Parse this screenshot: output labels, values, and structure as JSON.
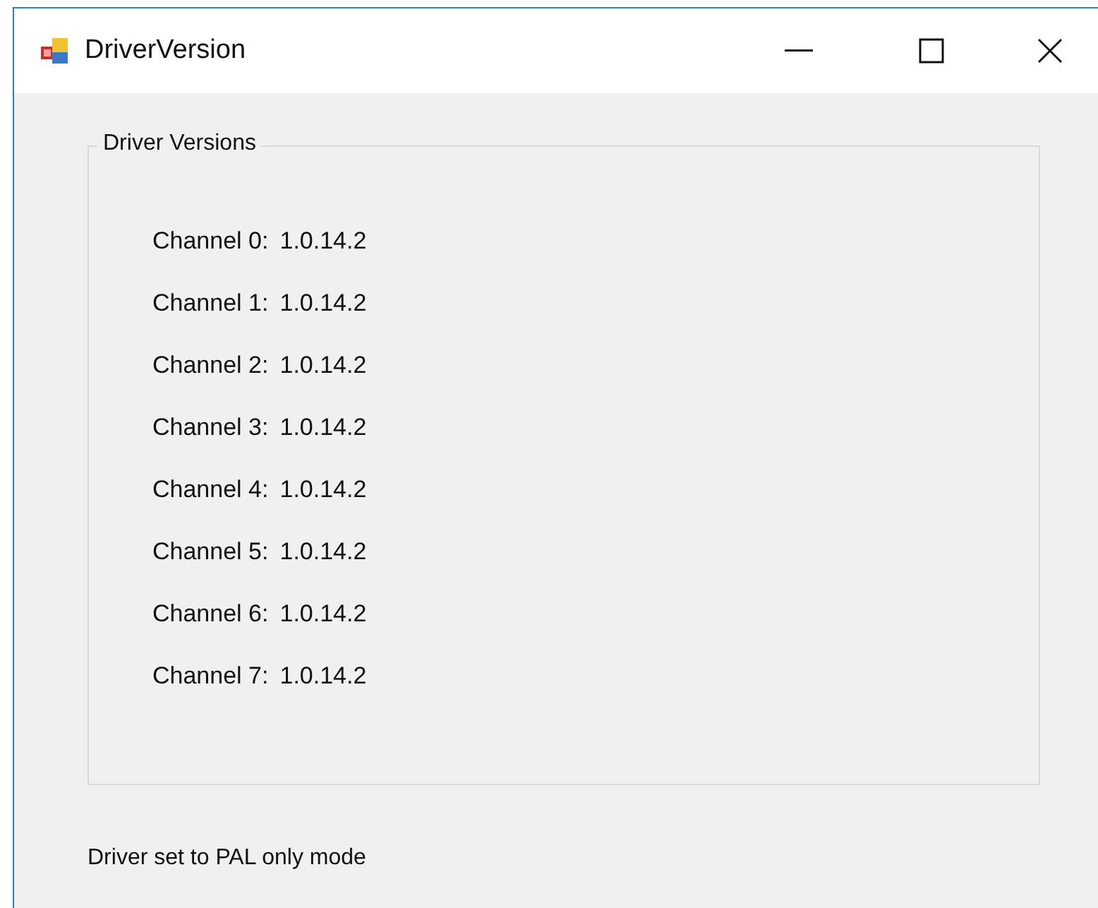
{
  "window": {
    "title": "DriverVersion"
  },
  "group": {
    "title": "Driver Versions",
    "channels": [
      {
        "label": "Channel 0:",
        "version": "1.0.14.2"
      },
      {
        "label": "Channel 1:",
        "version": "1.0.14.2"
      },
      {
        "label": "Channel 2:",
        "version": "1.0.14.2"
      },
      {
        "label": "Channel 3:",
        "version": "1.0.14.2"
      },
      {
        "label": "Channel 4:",
        "version": "1.0.14.2"
      },
      {
        "label": "Channel 5:",
        "version": "1.0.14.2"
      },
      {
        "label": "Channel 6:",
        "version": "1.0.14.2"
      },
      {
        "label": "Channel 7:",
        "version": "1.0.14.2"
      }
    ]
  },
  "status": "Driver set to PAL only mode"
}
